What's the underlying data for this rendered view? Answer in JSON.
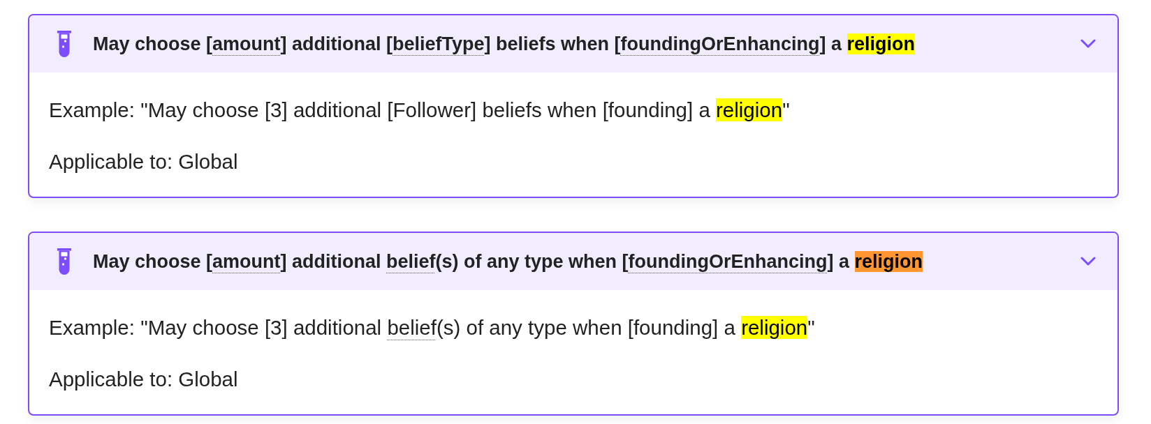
{
  "cards": [
    {
      "title": [
        {
          "text": "May choose [",
          "kind": "plain"
        },
        {
          "text": "amount",
          "kind": "term"
        },
        {
          "text": "] additional [",
          "kind": "plain"
        },
        {
          "text": "beliefType",
          "kind": "term"
        },
        {
          "text": "] beliefs when [",
          "kind": "plain"
        },
        {
          "text": "foundingOrEnhancing",
          "kind": "term"
        },
        {
          "text": "] a ",
          "kind": "plain"
        },
        {
          "text": "religion",
          "kind": "hit"
        }
      ],
      "example": [
        {
          "text": "Example: \"May choose [3] additional [Follower] beliefs when [founding] a ",
          "kind": "plain"
        },
        {
          "text": "religion",
          "kind": "hit"
        },
        {
          "text": "\"",
          "kind": "plain"
        }
      ],
      "applicable": "Applicable to: Global"
    },
    {
      "title": [
        {
          "text": "May choose [",
          "kind": "plain"
        },
        {
          "text": "amount",
          "kind": "term"
        },
        {
          "text": "] additional ",
          "kind": "plain"
        },
        {
          "text": "belief",
          "kind": "term"
        },
        {
          "text": "(s) of any type when [",
          "kind": "plain"
        },
        {
          "text": "foundingOrEnhancing",
          "kind": "term"
        },
        {
          "text": "] a ",
          "kind": "plain"
        },
        {
          "text": "religion",
          "kind": "current"
        }
      ],
      "example": [
        {
          "text": "Example: \"May choose [3] additional ",
          "kind": "plain"
        },
        {
          "text": "belief",
          "kind": "term"
        },
        {
          "text": "(s) of any type when [founding] a ",
          "kind": "plain"
        },
        {
          "text": "religion",
          "kind": "hit"
        },
        {
          "text": "\"",
          "kind": "plain"
        }
      ],
      "applicable": "Applicable to: Global"
    }
  ]
}
